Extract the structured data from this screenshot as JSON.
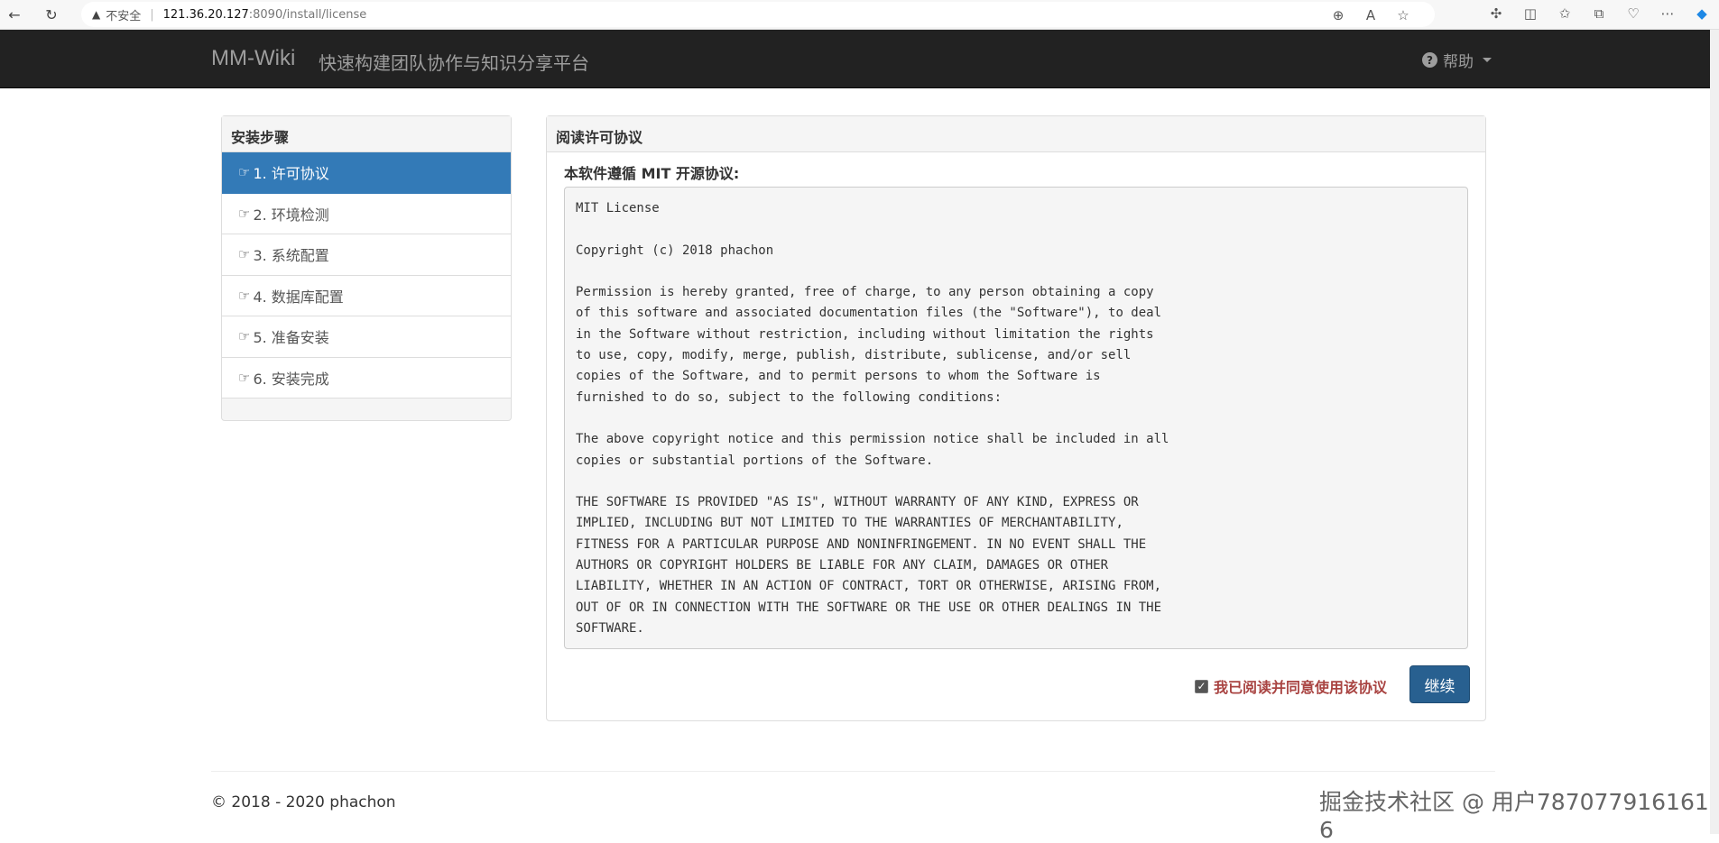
{
  "browser": {
    "insecure_label": "不安全",
    "url_host": "121.36.20.127",
    "url_path": ":8090/install/license"
  },
  "navbar": {
    "brand": "MM-Wiki",
    "subtitle": "快速构建团队协作与知识分享平台",
    "help_label": "帮助"
  },
  "steps": {
    "heading": "安装步骤",
    "items": [
      {
        "label": "1. 许可协议"
      },
      {
        "label": "2. 环境检测"
      },
      {
        "label": "3. 系统配置"
      },
      {
        "label": "4. 数据库配置"
      },
      {
        "label": "5. 准备安装"
      },
      {
        "label": "6. 安装完成"
      }
    ]
  },
  "license": {
    "heading": "阅读许可协议",
    "intro": "本软件遵循 MIT 开源协议:",
    "text": "MIT License\n\nCopyright (c) 2018 phachon\n\nPermission is hereby granted, free of charge, to any person obtaining a copy\nof this software and associated documentation files (the \"Software\"), to deal\nin the Software without restriction, including without limitation the rights\nto use, copy, modify, merge, publish, distribute, sublicense, and/or sell\ncopies of the Software, and to permit persons to whom the Software is\nfurnished to do so, subject to the following conditions:\n\nThe above copyright notice and this permission notice shall be included in all\ncopies or substantial portions of the Software.\n\nTHE SOFTWARE IS PROVIDED \"AS IS\", WITHOUT WARRANTY OF ANY KIND, EXPRESS OR\nIMPLIED, INCLUDING BUT NOT LIMITED TO THE WARRANTIES OF MERCHANTABILITY,\nFITNESS FOR A PARTICULAR PURPOSE AND NONINFRINGEMENT. IN NO EVENT SHALL THE\nAUTHORS OR COPYRIGHT HOLDERS BE LIABLE FOR ANY CLAIM, DAMAGES OR OTHER\nLIABILITY, WHETHER IN AN ACTION OF CONTRACT, TORT OR OTHERWISE, ARISING FROM,\nOUT OF OR IN CONNECTION WITH THE SOFTWARE OR THE USE OR OTHER DEALINGS IN THE\nSOFTWARE.",
    "agree_label": "我已阅读并同意使用该协议",
    "agree_checked": true,
    "continue_label": "继续"
  },
  "footer": {
    "copyright": "© 2018 - 2020 phachon",
    "watermark": "掘金技术社区 @ 用户787077916161​6"
  }
}
